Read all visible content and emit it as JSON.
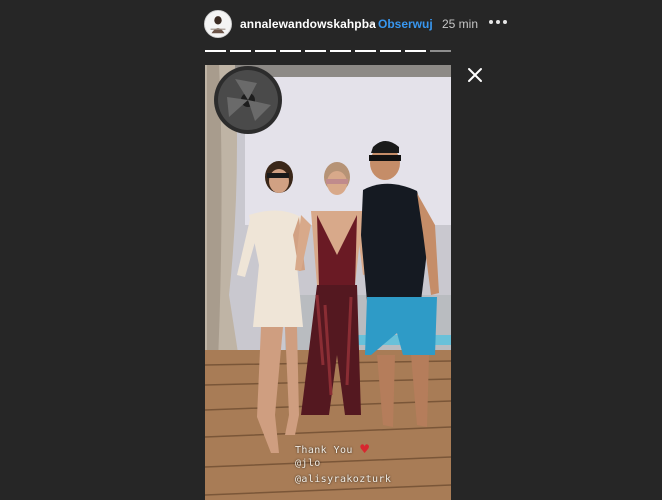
{
  "header": {
    "username": "annalewandowskahpba",
    "separator": "•",
    "follow_label": "Obserwuj",
    "time_ago": "25 min"
  },
  "story": {
    "total_segments": 10,
    "active_segment": 10,
    "caption": {
      "line1": "Thank You",
      "line2": "@jlo",
      "line3": "@alisyrakozturk"
    }
  },
  "colors": {
    "background": "#262626",
    "follow_blue": "#3897f0",
    "heart_red": "#d8272f"
  },
  "icons": {
    "more": "more-horizontal-icon",
    "close": "close-icon",
    "heart": "heart-icon"
  }
}
